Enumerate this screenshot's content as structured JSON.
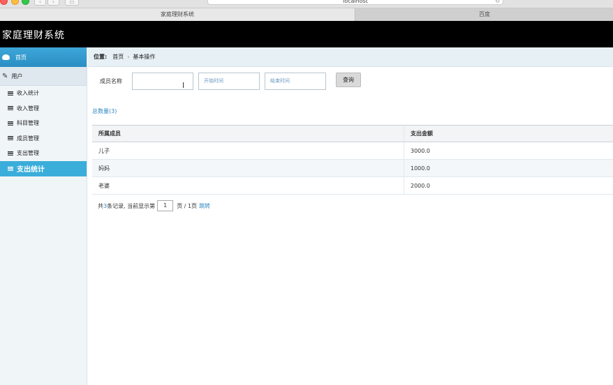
{
  "browser": {
    "url": "localhost",
    "tabs": [
      "家庭理财系统",
      "百度"
    ]
  },
  "app": {
    "title": "家庭理财系统"
  },
  "sidebar": {
    "home_label": "首页",
    "user_label": "用户",
    "items": [
      {
        "label": "收入统计",
        "active": false
      },
      {
        "label": "收入管理",
        "active": false
      },
      {
        "label": "科目管理",
        "active": false
      },
      {
        "label": "成员管理",
        "active": false
      },
      {
        "label": "支出管理",
        "active": false
      },
      {
        "label": "支出统计",
        "active": true
      }
    ]
  },
  "breadcrumb": {
    "label": "位置:",
    "path": [
      "首页",
      "基本操作"
    ],
    "separator": "›"
  },
  "search": {
    "member_label": "成员名称",
    "member_value": "",
    "start_placeholder": "开始时间",
    "end_placeholder": "结束时间",
    "query_button": "查询"
  },
  "summary": {
    "total_text": "总数量(3)"
  },
  "table": {
    "headers": [
      "所属成员",
      "支出金额"
    ],
    "rows": [
      [
        "儿子",
        "3000.0"
      ],
      [
        "妈妈",
        "1000.0"
      ],
      [
        "老婆",
        "2000.0"
      ]
    ]
  },
  "pager": {
    "prefix": "共",
    "count": "3",
    "suffix": "条记录, 当前显示第",
    "page_value": "1",
    "page_total": "页 / 1页",
    "jump": "跳转"
  },
  "colors": {
    "header_bg": "#000000",
    "accent": "#3badda",
    "link": "#2d86c3"
  }
}
